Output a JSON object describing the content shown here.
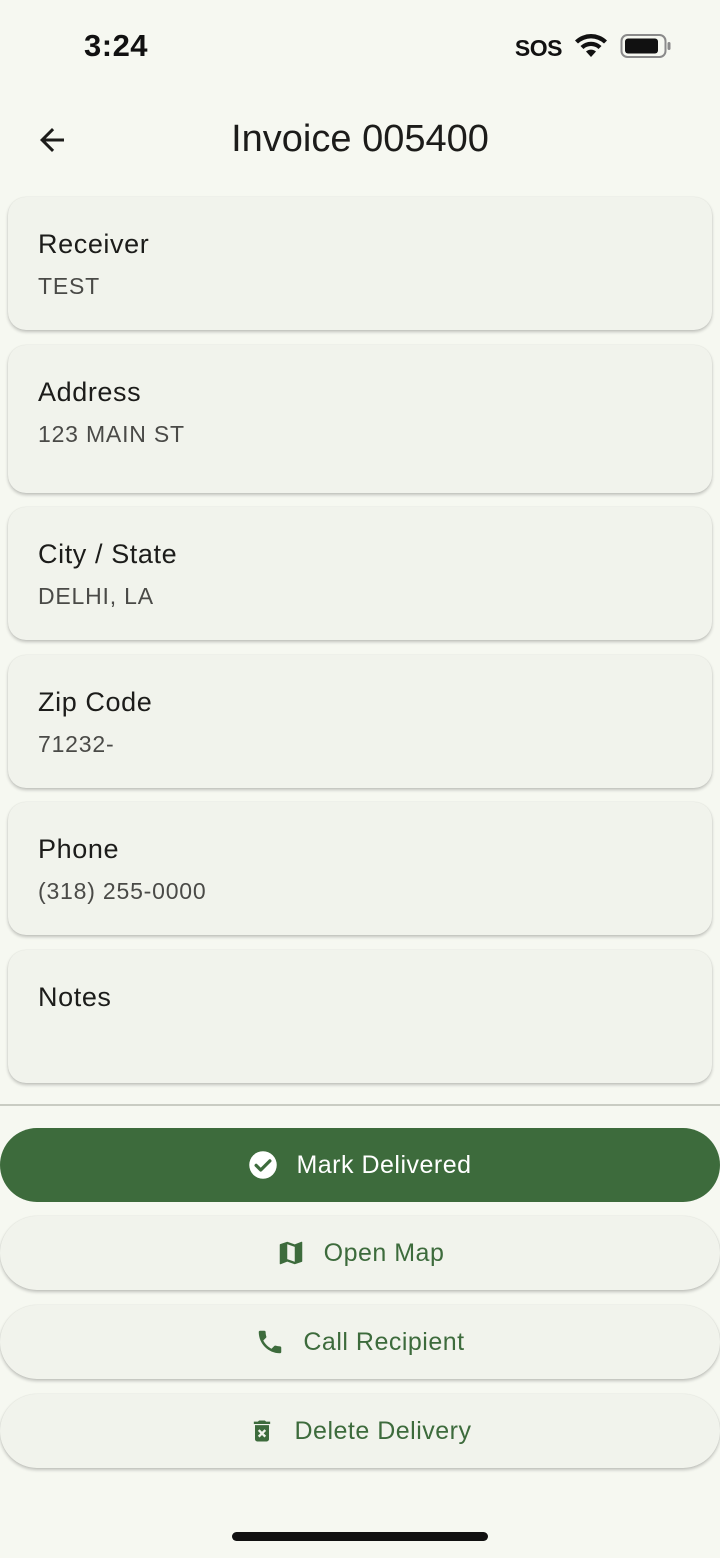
{
  "status_bar": {
    "time": "3:24",
    "sos": "SOS",
    "icons": [
      "wifi-icon",
      "battery-icon"
    ]
  },
  "app_bar": {
    "title": "Invoice 005400",
    "back_icon": "arrow-left-icon"
  },
  "fields": {
    "receiver": {
      "label": "Receiver",
      "value": "TEST"
    },
    "address": {
      "label": "Address",
      "value": "123 MAIN ST"
    },
    "city_state": {
      "label": "City / State",
      "value": "DELHI, LA"
    },
    "zip": {
      "label": "Zip Code",
      "value": "71232-"
    },
    "phone": {
      "label": "Phone",
      "value": "(318) 255-0000"
    },
    "notes": {
      "label": "Notes",
      "value": ""
    }
  },
  "actions": {
    "mark_delivered": {
      "label": "Mark Delivered",
      "icon": "check-circle-icon"
    },
    "open_map": {
      "label": "Open Map",
      "icon": "map-icon"
    },
    "call_recipient": {
      "label": "Call Recipient",
      "icon": "phone-icon"
    },
    "delete_delivery": {
      "label": "Delete Delivery",
      "icon": "delete-icon"
    }
  },
  "colors": {
    "background": "#f6f8f1",
    "card": "#f1f3ec",
    "primary": "#3d6b3c",
    "on_primary": "#ffffff"
  }
}
